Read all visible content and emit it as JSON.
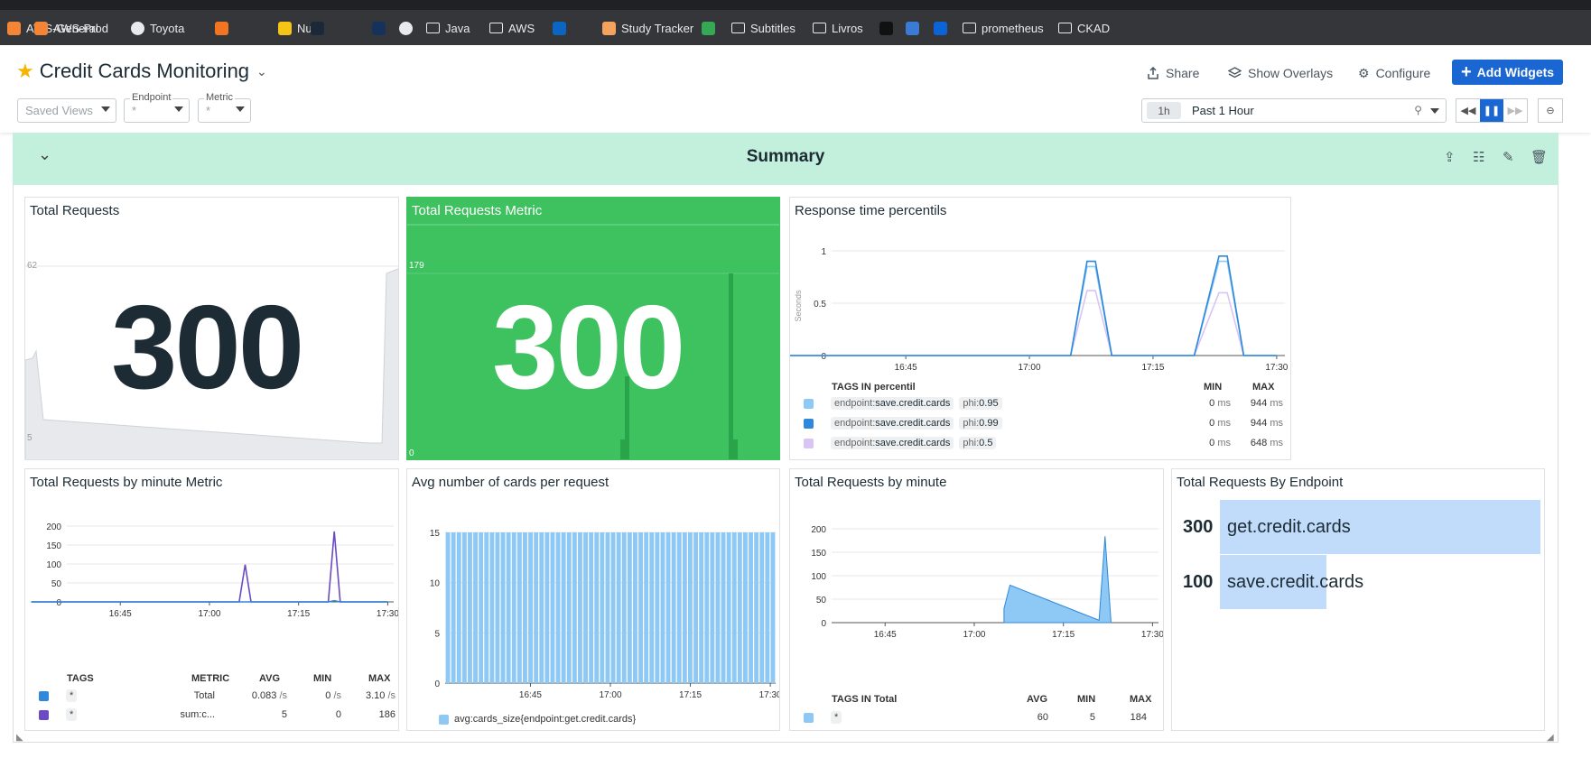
{
  "bookmarks": [
    {
      "label": "AWS-General",
      "icon": "aws-icon",
      "color": "#f58536"
    },
    {
      "label": "AWS-Prod",
      "icon": "aws-icon",
      "color": "#f58536"
    },
    {
      "label": "Toyota",
      "icon": "globe-icon",
      "color": "#e8eaed"
    },
    {
      "label": "",
      "icon": "crunchyroll-icon",
      "color": "#f47521"
    },
    {
      "label": "Nutri",
      "icon": "nutri-icon",
      "color": "#f5c518"
    },
    {
      "label": "",
      "icon": "steam-icon",
      "color": "#1b2838"
    },
    {
      "label": "",
      "icon": "dark-icon",
      "color": "#16325c"
    },
    {
      "label": "",
      "icon": "github-icon",
      "color": "#e8eaed"
    },
    {
      "label": "Java",
      "icon": "folder-icon",
      "color": ""
    },
    {
      "label": "AWS",
      "icon": "folder-icon",
      "color": ""
    },
    {
      "label": "",
      "icon": "linkedin-icon",
      "color": "#0a66c2"
    },
    {
      "label": "Study Tracker",
      "icon": "study-icon",
      "color": "#f3a35b"
    },
    {
      "label": "",
      "icon": "drive-icon",
      "color": "#34a853"
    },
    {
      "label": "Subtitles",
      "icon": "folder-icon",
      "color": ""
    },
    {
      "label": "Livros",
      "icon": "folder-icon",
      "color": ""
    },
    {
      "label": "",
      "icon": "ne-icon",
      "color": "#111111"
    },
    {
      "label": "",
      "icon": "windows-icon",
      "color": "#3a7bd5"
    },
    {
      "label": "",
      "icon": "outlook-icon",
      "color": "#0a64d6"
    },
    {
      "label": "prometheus",
      "icon": "folder-icon",
      "color": ""
    },
    {
      "label": "CKAD",
      "icon": "folder-icon",
      "color": ""
    }
  ],
  "header": {
    "title": "Credit Cards Monitoring",
    "share": "Share",
    "overlays": "Show Overlays",
    "configure": "Configure",
    "add_widgets": "Add Widgets",
    "saved_views": "Saved Views",
    "endpoint_label": "Endpoint",
    "endpoint_value": "*",
    "metric_label": "Metric",
    "metric_value": "*",
    "time_pill": "1h",
    "time_text": "Past 1 Hour"
  },
  "summary": {
    "title": "Summary"
  },
  "widgets": {
    "total_requests": {
      "title": "Total Requests",
      "value": "300",
      "spark_max": "62",
      "spark_min": "5"
    },
    "total_requests_metric": {
      "title": "Total Requests Metric",
      "value": "300",
      "spark_max": "179",
      "spark_min": "0",
      "bg": "#3ec15f"
    },
    "response_time": {
      "title": "Response time percentils",
      "ylabel": "Seconds",
      "yticks": [
        "1",
        "0.5",
        "0"
      ],
      "xticks": [
        "16:45",
        "17:00",
        "17:15",
        "17:30"
      ],
      "legend_header": "TAGS IN percentil",
      "col_min": "MIN",
      "col_max": "MAX",
      "rows": [
        {
          "key": "endpoint:",
          "val": "save.credit.cards",
          "tag2k": "phi:",
          "tag2v": "0.95",
          "min": "0",
          "max": "944",
          "unit": "ms",
          "color": "#8ec8f5"
        },
        {
          "key": "endpoint:",
          "val": "save.credit.cards",
          "tag2k": "phi:",
          "tag2v": "0.99",
          "min": "0",
          "max": "944",
          "unit": "ms",
          "color": "#2f88d9"
        },
        {
          "key": "endpoint:",
          "val": "save.credit.cards",
          "tag2k": "phi:",
          "tag2v": "0.5",
          "min": "0",
          "max": "648",
          "unit": "ms",
          "color": "#d8c4f5"
        }
      ]
    },
    "by_minute_metric": {
      "title": "Total Requests by minute Metric",
      "yticks": [
        "200",
        "150",
        "100",
        "50",
        "0"
      ],
      "xticks": [
        "16:45",
        "17:00",
        "17:15",
        "17:30"
      ],
      "headers": {
        "tags": "TAGS",
        "metric": "METRIC",
        "avg": "AVG",
        "min": "MIN",
        "max": "MAX"
      },
      "rows": [
        {
          "tag": "*",
          "metric": "Total",
          "avg": "0.083",
          "avg_unit": "/s",
          "min": "0",
          "min_unit": "/s",
          "max": "3.10",
          "max_unit": "/s",
          "color": "#2f88d9"
        },
        {
          "tag": "*",
          "metric": "sum:c...",
          "avg": "5",
          "avg_unit": "",
          "min": "0",
          "min_unit": "",
          "max": "186",
          "max_unit": "",
          "color": "#6a4bc4"
        }
      ]
    },
    "avg_cards": {
      "title": "Avg number of cards per request",
      "yticks": [
        "15",
        "10",
        "5",
        "0"
      ],
      "xticks": [
        "16:45",
        "17:00",
        "17:15",
        "17:30"
      ],
      "legend": "avg:cards_size{endpoint:get.credit.cards}",
      "color": "#8ec8f5"
    },
    "by_minute": {
      "title": "Total Requests by minute",
      "yticks": [
        "200",
        "150",
        "100",
        "50",
        "0"
      ],
      "xticks": [
        "16:45",
        "17:00",
        "17:15",
        "17:30"
      ],
      "legend_header": "TAGS IN Total",
      "col_avg": "AVG",
      "col_min": "MIN",
      "col_max": "MAX",
      "row": {
        "tag": "*",
        "avg": "60",
        "min": "5",
        "max": "184",
        "color": "#8ec8f5"
      }
    },
    "by_endpoint": {
      "title": "Total Requests By Endpoint",
      "items": [
        {
          "value": "300",
          "label": "get.credit.cards"
        },
        {
          "value": "100",
          "label": "save.credit.cards"
        }
      ]
    }
  },
  "chart_data": [
    {
      "type": "line",
      "title": "Response time percentils",
      "ylabel": "Seconds",
      "ylim": [
        0,
        1
      ],
      "x": [
        "16:30",
        "16:45",
        "17:00",
        "17:05",
        "17:07",
        "17:08",
        "17:10",
        "17:20",
        "17:23",
        "17:24",
        "17:26",
        "17:30"
      ],
      "series": [
        {
          "name": "endpoint:save.credit.cards phi:0.95",
          "values": [
            0,
            0,
            0,
            0,
            0.85,
            0.85,
            0,
            0,
            0.9,
            0.9,
            0,
            0
          ]
        },
        {
          "name": "endpoint:save.credit.cards phi:0.99",
          "values": [
            0,
            0,
            0,
            0,
            0.9,
            0.9,
            0,
            0,
            0.95,
            0.95,
            0,
            0
          ]
        },
        {
          "name": "endpoint:save.credit.cards phi:0.5",
          "values": [
            0,
            0,
            0,
            0,
            0.62,
            0.62,
            0,
            0,
            0.6,
            0.6,
            0,
            0
          ]
        }
      ]
    },
    {
      "type": "line",
      "title": "Total Requests by minute Metric",
      "ylim": [
        0,
        200
      ],
      "x": [
        "16:30",
        "16:45",
        "17:00",
        "17:05",
        "17:06",
        "17:07",
        "17:20",
        "17:21",
        "17:22",
        "17:30"
      ],
      "series": [
        {
          "name": "Total",
          "values": [
            0,
            0,
            0,
            0,
            0,
            0,
            0,
            3,
            0,
            0
          ]
        },
        {
          "name": "sum:c...",
          "values": [
            0,
            0,
            0,
            0,
            98,
            0,
            0,
            186,
            0,
            0
          ]
        }
      ]
    },
    {
      "type": "bar",
      "title": "Avg number of cards per request",
      "ylim": [
        0,
        15
      ],
      "x_range": [
        "16:30",
        "17:30"
      ],
      "series": [
        {
          "name": "avg:cards_size{endpoint:get.credit.cards}",
          "constant_value": 15,
          "bar_count": 60
        }
      ]
    },
    {
      "type": "area",
      "title": "Total Requests by minute",
      "ylim": [
        0,
        200
      ],
      "x": [
        "17:05",
        "17:06",
        "17:21",
        "17:22",
        "17:23"
      ],
      "series": [
        {
          "name": "Total",
          "values": [
            30,
            80,
            5,
            184,
            5
          ]
        }
      ]
    },
    {
      "type": "bar",
      "title": "Total Requests By Endpoint",
      "categories": [
        "get.credit.cards",
        "save.credit.cards"
      ],
      "values": [
        300,
        100
      ]
    }
  ]
}
